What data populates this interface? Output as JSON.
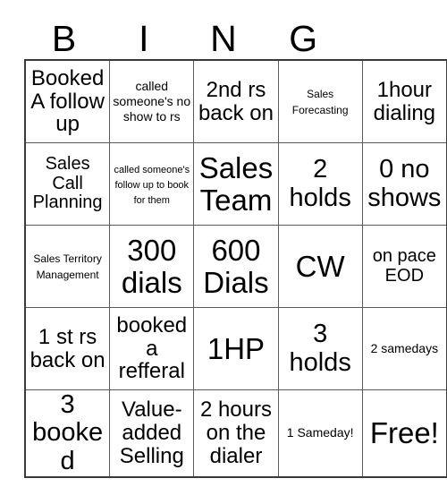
{
  "card": {
    "header_letters": [
      "B",
      "I",
      "N",
      "G",
      ""
    ],
    "rows": [
      [
        {
          "text": "Booked A follow up",
          "size": "fs-lg"
        },
        {
          "text": "called someone's no show to rs",
          "size": "fs-sm"
        },
        {
          "text": "2nd rs back on",
          "size": "fs-lg"
        },
        {
          "text": "Sales Forecasting",
          "size": "fs-xs"
        },
        {
          "text": "1hour dialing",
          "size": "fs-lg"
        }
      ],
      [
        {
          "text": "Sales Call Planning",
          "size": "fs-md"
        },
        {
          "text": "called someone's follow up to book for them",
          "size": "fs-xxs"
        },
        {
          "text": "Sales Team",
          "size": "fs-xxl"
        },
        {
          "text": "2 holds",
          "size": "fs-xl"
        },
        {
          "text": "0 no shows",
          "size": "fs-xl"
        }
      ],
      [
        {
          "text": "Sales Territory Management",
          "size": "fs-xs"
        },
        {
          "text": "300 dials",
          "size": "fs-xxl"
        },
        {
          "text": "600 Dials",
          "size": "fs-xxl"
        },
        {
          "text": "CW",
          "size": "fs-xxl"
        },
        {
          "text": "on pace EOD",
          "size": "fs-md"
        }
      ],
      [
        {
          "text": "1 st rs back on",
          "size": "fs-lg"
        },
        {
          "text": "booked a refferal",
          "size": "fs-lg"
        },
        {
          "text": "1HP",
          "size": "fs-xxl"
        },
        {
          "text": "3 holds",
          "size": "fs-xl"
        },
        {
          "text": "2 samedays",
          "size": "fs-sm"
        }
      ],
      [
        {
          "text": "3 booked",
          "size": "fs-xl"
        },
        {
          "text": "Value-added Selling",
          "size": "fs-lg"
        },
        {
          "text": "2 hours on the dialer",
          "size": "fs-lg"
        },
        {
          "text": "1 Sameday!",
          "size": "fs-sm"
        },
        {
          "text": "Free!",
          "size": "fs-xxl"
        }
      ]
    ]
  }
}
